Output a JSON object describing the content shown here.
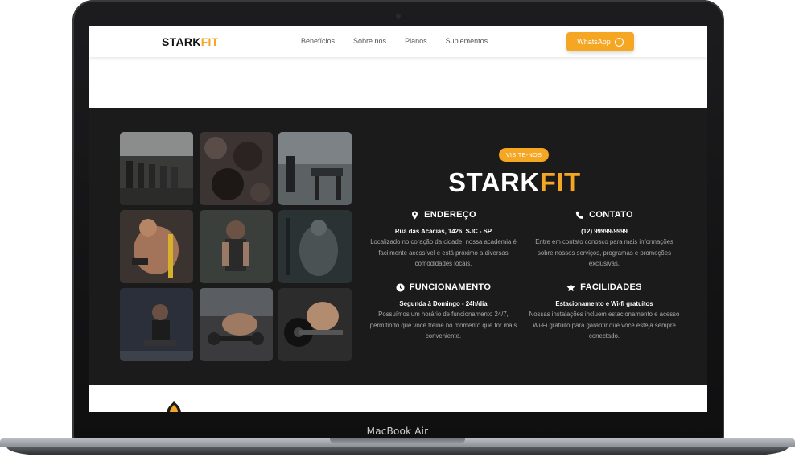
{
  "device": {
    "label": "MacBook Air"
  },
  "nav": {
    "logo_main": "STARK",
    "logo_accent": "FIT",
    "links": [
      "Benefícios",
      "Sobre nós",
      "Planos",
      "Suplementos"
    ],
    "cta_label": "WhatsApp"
  },
  "visit": {
    "badge": "VISITE-NOS",
    "logo_main": "STARK",
    "logo_accent": "FIT",
    "blocks": [
      {
        "title": "ENDEREÇO",
        "icon": "location-pin-icon",
        "subtitle": "Rua das Acácias, 1426, SJC - SP",
        "text": "Localizado no coração da cidade, nossa academia é facilmente acessível e está próximo a diversas comodidades locais."
      },
      {
        "title": "CONTATO",
        "icon": "phone-icon",
        "subtitle": "(12) 99999-9999",
        "text": "Entre em contato conosco para mais informações sobre nossos serviços, programas e promoções exclusivas."
      },
      {
        "title": "FUNCIONAMENTO",
        "icon": "clock-icon",
        "subtitle": "Segunda à Domingo - 24h/dia",
        "text": "Possuímos um horário de funcionamento 24/7, permitindo que você treine no momento que for mais conveniente."
      },
      {
        "title": "FACILIDADES",
        "icon": "star-icon",
        "subtitle": "Estacionamento e Wi-fi gratuitos",
        "text": "Nossas instalações incluem estacionamento e acesso Wi-Fi gratuito para garantir que você esteja sempre conectado."
      }
    ]
  },
  "colors": {
    "accent": "#f5a623",
    "dark_bg": "#1b1b1b"
  }
}
